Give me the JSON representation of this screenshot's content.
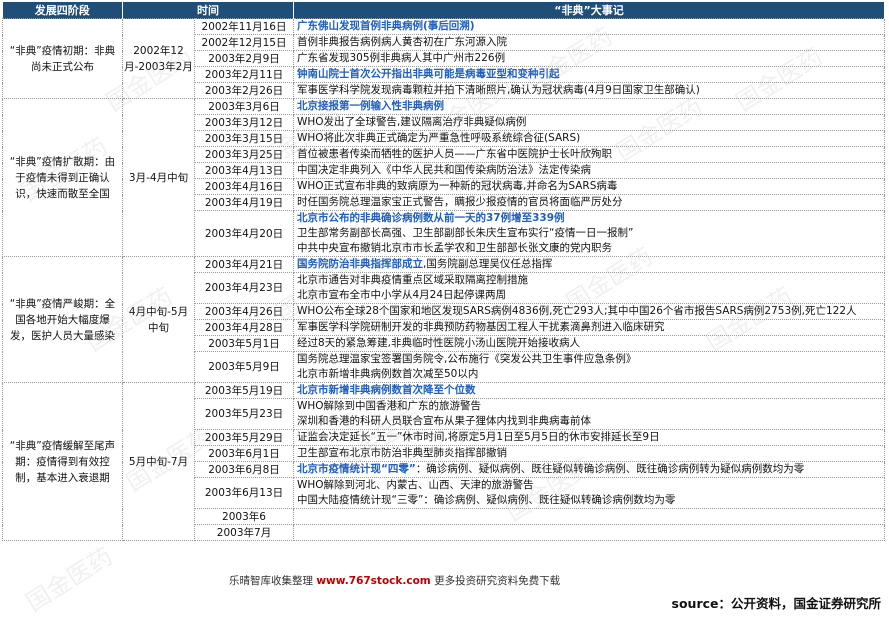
{
  "header": {
    "phase": "发展四阶段",
    "time": "时间",
    "events": "“非典”大事记"
  },
  "phases": [
    {
      "label": "“非典”疫情初期：非典尚未正式公布",
      "period": "2002年12月-2003年2月",
      "rows": [
        {
          "date": "2002年11月16日",
          "lines": [
            {
              "text": "广东佛山发现首例非典病例(事后回溯)",
              "hl": true
            }
          ]
        },
        {
          "date": "2002年12月15日",
          "lines": [
            {
              "text": "首例非典报告病例病人黄杏初在广东河源入院",
              "hl": false
            }
          ]
        },
        {
          "date": "2003年2月9日",
          "lines": [
            {
              "text": "广东省发现305例非典病人其中广州市226例",
              "hl": false
            }
          ]
        },
        {
          "date": "2003年2月11日",
          "lines": [
            {
              "text": "钟南山院士首次公开指出非典可能是病毒亚型和变种引起",
              "hl": true
            }
          ]
        },
        {
          "date": "2003年2月26日",
          "lines": [
            {
              "text": "军事医学科学院发现病毒颗粒并拍下清晰照片,确认为冠状病毒(4月9日国家卫生部确认)",
              "hl": false
            }
          ]
        }
      ]
    },
    {
      "label": "“非典”疫情扩散期：由于疫情未得到正确认识，快速而散至全国",
      "period": "3月-4月中旬",
      "rows": [
        {
          "date": "2003年3月6日",
          "lines": [
            {
              "text": "北京接报第一例输入性非典病例",
              "hl": true
            }
          ]
        },
        {
          "date": "2003年3月12日",
          "lines": [
            {
              "text": "WHO发出了全球警告,建议隔离治疗非典疑似病例",
              "hl": false
            }
          ]
        },
        {
          "date": "2003年3月15日",
          "lines": [
            {
              "text": "WHO将此次非典正式确定为严重急性呼吸系统综合征(SARS)",
              "hl": false
            }
          ]
        },
        {
          "date": "2003年3月25日",
          "lines": [
            {
              "text": "首位被患者传染而牺牲的医护人员——广东省中医院护士长叶欣殉职",
              "hl": false
            }
          ]
        },
        {
          "date": "2003年4月13日",
          "lines": [
            {
              "text": "中国决定非典列入《中华人民共和国传染病防治法》法定传染病",
              "hl": false
            }
          ]
        },
        {
          "date": "2003年4月16日",
          "lines": [
            {
              "text": "WHO正式宣布非典的致病原为一种新的冠状病毒,并命名为SARS病毒",
              "hl": false
            }
          ]
        },
        {
          "date": "2003年4月19日",
          "lines": [
            {
              "text": "时任国务院总理温家宝正式警告，瞒报少报疫情的官员将面临严厉处分",
              "hl": false
            }
          ]
        },
        {
          "date": "2003年4月20日",
          "lines": [
            {
              "text": "北京市公布的非典确诊病例数从前一天的37例增至339例",
              "hl": true
            },
            {
              "text": "卫生部常务副部长高强、卫生部副部长朱庆生宣布实行“疫情一日一报制”",
              "hl": false
            },
            {
              "text": "中共中央宣布撤销北京市市长孟学农和卫生部部长张文康的党内职务",
              "hl": false
            }
          ]
        }
      ]
    },
    {
      "label": "“非典”疫情严峻期：全国各地开始大幅度爆发，医护人员大量感染",
      "period": "4月中旬-5月中旬",
      "rows": [
        {
          "date": "2003年4月21日",
          "lines": [
            {
              "text": "国务院防治非典指挥部成立",
              "hl": true,
              "tail": ",国务院副总理吴仪任总指挥"
            }
          ]
        },
        {
          "date": "2003年4月23日",
          "lines": [
            {
              "text": "北京市通告对非典疫情重点区域采取隔离控制措施",
              "hl": false
            },
            {
              "text": "北京市宣布全市中小学从4月24日起停课两周",
              "hl": false
            }
          ]
        },
        {
          "date": "2003年4月26日",
          "lines": [
            {
              "text": "WHO公布全球28个国家和地区发现SARS病例4836例,死亡293人;其中中国26个省市报告SARS病例2753例,死亡122人",
              "hl": false,
              "wrap": true
            }
          ]
        },
        {
          "date": "2003年4月28日",
          "lines": [
            {
              "text": "军事医学科学院研制开发的非典预防药物基因工程人干扰素滴鼻剂进入临床研究",
              "hl": false
            }
          ]
        },
        {
          "date": "2003年5月1日",
          "lines": [
            {
              "text": "经过8天的紧急筹建,非典临时性医院小汤山医院开始接收病人",
              "hl": false
            }
          ]
        },
        {
          "date": "2003年5月9日",
          "lines": [
            {
              "text": "国务院总理温家宝签署国务院令,公布施行《突发公共卫生事件应急条例》",
              "hl": false
            },
            {
              "text": "北京市新增非典病例数首次减至50以内",
              "hl": false
            }
          ]
        }
      ]
    },
    {
      "label": "“非典”疫情缓解至尾声期：疫情得到有效控制，基本进入衰退期",
      "period": "5月中旬-7月",
      "rows": [
        {
          "date": "2003年5月19日",
          "lines": [
            {
              "text": "北京市新增非典病例数首次降至个位数",
              "hl": true
            }
          ]
        },
        {
          "date": "2003年5月23日",
          "lines": [
            {
              "text": "WHO解除到中国香港和广东的旅游警告",
              "hl": false
            },
            {
              "text": "深圳和香港的科研人员联合宣布从果子狸体内找到非典病毒前体",
              "hl": false
            }
          ]
        },
        {
          "date": "2003年5月29日",
          "lines": [
            {
              "text": "证监会决定延长“五一”休市时间,将原定5月1日至5月5日的休市安排延长至9日",
              "hl": false
            }
          ]
        },
        {
          "date": "2003年6月1日",
          "lines": [
            {
              "text": "卫生部宣布北京市防治非典型肺炎指挥部撤销",
              "hl": false
            }
          ]
        },
        {
          "date": "2003年6月8日",
          "lines": [
            {
              "text": "北京市疫情统计现“四零”",
              "hl": true,
              "tail": "：确诊病例、疑似病例、既往疑似转确诊病例、既往确诊病例转为疑似病例数均为零",
              "wrap": true
            }
          ]
        },
        {
          "date": "2003年6月13日",
          "lines": [
            {
              "text": "WHO解除到河北、内蒙古、山西、天津的旅游警告",
              "hl": false
            },
            {
              "text": "中国大陆疫情统计现“三零”：确诊病例、疑似病例、既往疑似转确诊病例数均为零",
              "hl": false
            }
          ]
        },
        {
          "date": "2003年6",
          "lines": [
            {
              "text": "",
              "hl": false
            }
          ]
        },
        {
          "date": "2003年7月",
          "lines": [
            {
              "text": "",
              "hl": false
            }
          ]
        }
      ]
    }
  ],
  "footer": {
    "prefix": "乐晴智库收集整理",
    "url": "www.767stock.com",
    "suffix": "更多投资研究资料免费下载"
  },
  "source": "source：公开资料，国金证券研究所",
  "watermark": "国金医药"
}
